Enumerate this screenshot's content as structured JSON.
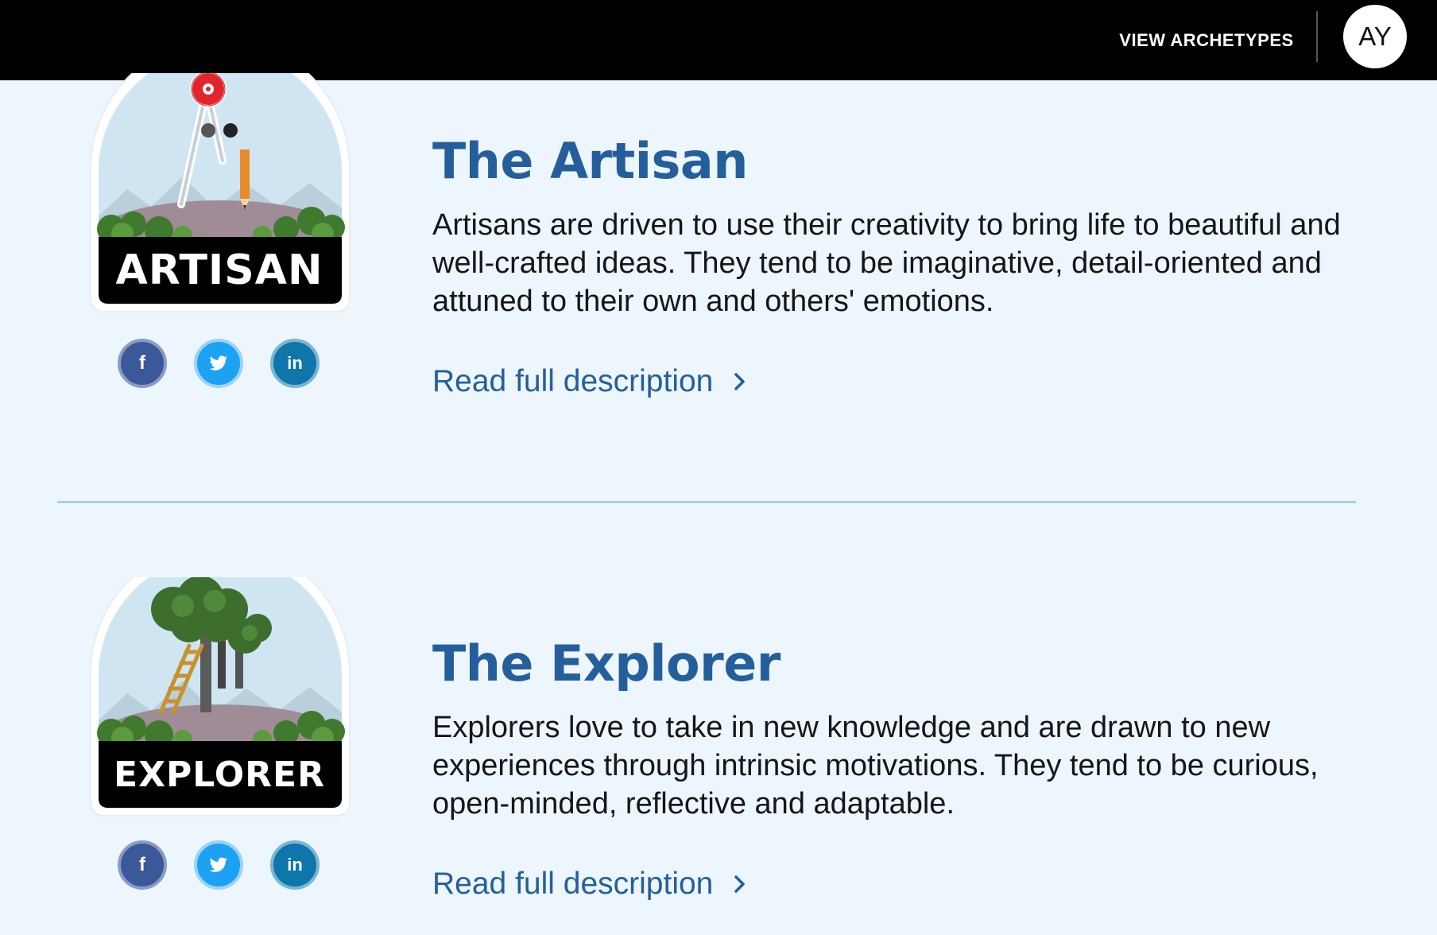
{
  "header": {
    "nav_label": "VIEW ARCHETYPES",
    "avatar_initials": "AY"
  },
  "cards": [
    {
      "badge_label": "ARTISAN",
      "title": "The Artisan",
      "description": "Artisans are driven to use their creativity to bring life to beautiful and well-crafted ideas. They tend to be imaginative, detail-oriented and attuned to their own and others' emotions.",
      "link_label": "Read full description",
      "social": {
        "facebook": "f",
        "twitter": "t",
        "linkedin": "in"
      }
    },
    {
      "badge_label": "EXPLORER",
      "title": "The Explorer",
      "description": "Explorers love to take in new knowledge and are drawn to new experiences through intrinsic motivations. They tend to be curious, open-minded, reflective and adaptable.",
      "link_label": "Read full description",
      "social": {
        "facebook": "f",
        "twitter": "t",
        "linkedin": "in"
      }
    }
  ],
  "colors": {
    "accent": "#245f9c",
    "background": "#edf5fd",
    "topbar": "#000000",
    "divider": "#a9d0ec"
  }
}
